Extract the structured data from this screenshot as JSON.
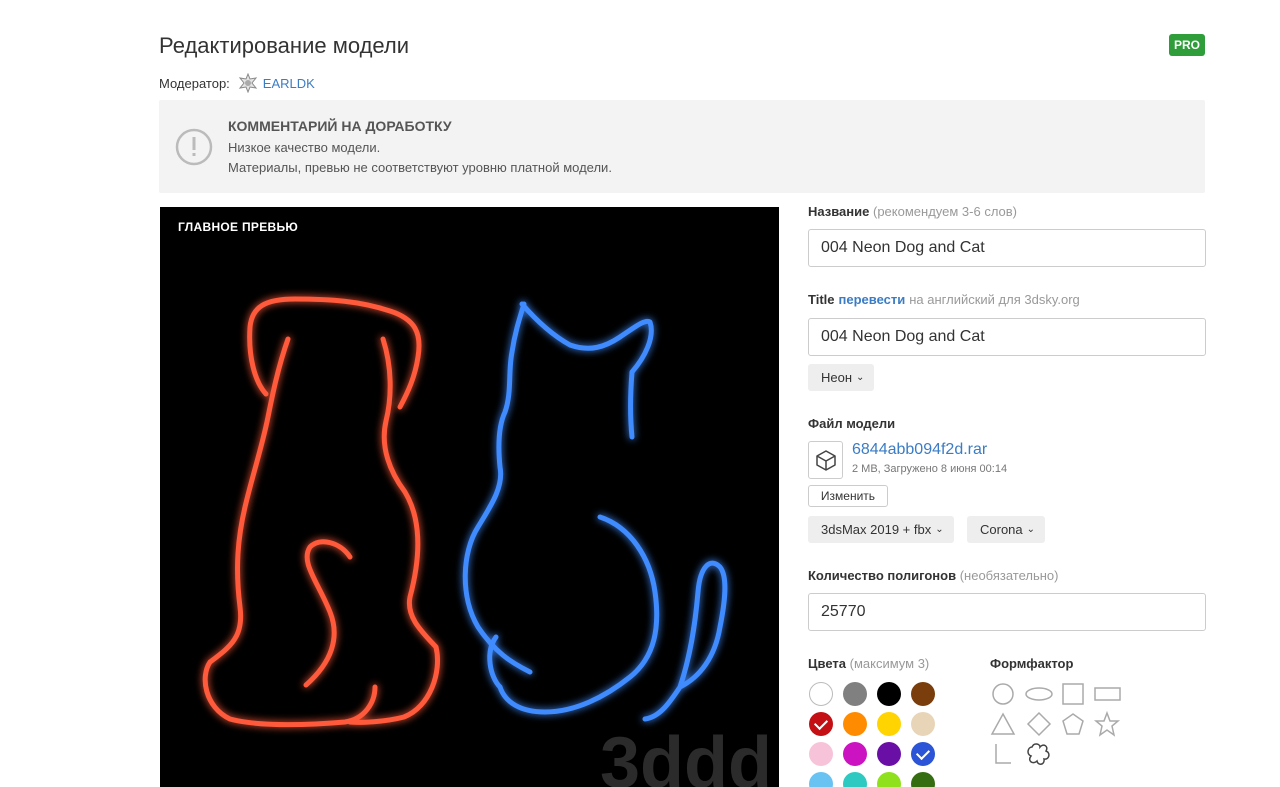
{
  "header": {
    "title": "Редактирование модели",
    "pro_badge": "PRO",
    "moderator_label": "Модератор:",
    "moderator_name": "EARLDK"
  },
  "comment": {
    "title": "КОММЕНТАРИЙ НА ДОРАБОТКУ",
    "line1": "Низкое качество модели.",
    "line2": "Материалы, превью не соответствуют уровню платной модели."
  },
  "preview": {
    "label": "ГЛАВНОЕ ПРЕВЬЮ",
    "watermark": "3ddd"
  },
  "form": {
    "name_label": "Название",
    "name_hint": "(рекомендуем 3-6 слов)",
    "name_value": "004 Neon Dog and Cat",
    "title_label": "Title",
    "title_translate_link": "перевести",
    "title_hint": "на английский для 3dsky.org",
    "title_value": "004 Neon Dog and Cat",
    "category_chip": "Неон",
    "file_label": "Файл модели",
    "file_name": "6844abb094f2d.rar",
    "file_meta": "2 MB, Загружено 8 июня 00:14",
    "change_button": "Изменить",
    "format_chip": "3dsMax 2019 + fbx",
    "render_chip": "Corona",
    "polygons_label": "Количество полигонов",
    "polygons_hint": "(необязательно)",
    "polygons_value": "25770",
    "colors_label": "Цвета",
    "colors_hint": "(максимум 3)",
    "formfactor_label": "Формфактор"
  },
  "colors": [
    {
      "name": "white",
      "hex": "#ffffff",
      "selected": false
    },
    {
      "name": "gray",
      "hex": "#808080",
      "selected": false
    },
    {
      "name": "black",
      "hex": "#000000",
      "selected": false
    },
    {
      "name": "brown",
      "hex": "#7a3d0c",
      "selected": false
    },
    {
      "name": "red",
      "hex": "#c40f14",
      "selected": true
    },
    {
      "name": "orange",
      "hex": "#ff8c00",
      "selected": false
    },
    {
      "name": "yellow",
      "hex": "#ffd400",
      "selected": false
    },
    {
      "name": "beige",
      "hex": "#e8d5b8",
      "selected": false
    },
    {
      "name": "pink",
      "hex": "#f7c3d8",
      "selected": false
    },
    {
      "name": "magenta",
      "hex": "#cc13c1",
      "selected": false
    },
    {
      "name": "purple",
      "hex": "#6a0fa6",
      "selected": false
    },
    {
      "name": "blue",
      "hex": "#2b54d6",
      "selected": true
    },
    {
      "name": "light-blue",
      "hex": "#68c2f2",
      "selected": false
    },
    {
      "name": "turquoise",
      "hex": "#2ec9c0",
      "selected": false
    },
    {
      "name": "light-green",
      "hex": "#8fe01d",
      "selected": false
    },
    {
      "name": "dark-green",
      "hex": "#356e10",
      "selected": false
    }
  ],
  "formfactors": [
    "circle",
    "ellipse",
    "square",
    "rectangle",
    "triangle",
    "diamond",
    "pentagon",
    "star",
    "l-shape",
    "freeform"
  ]
}
